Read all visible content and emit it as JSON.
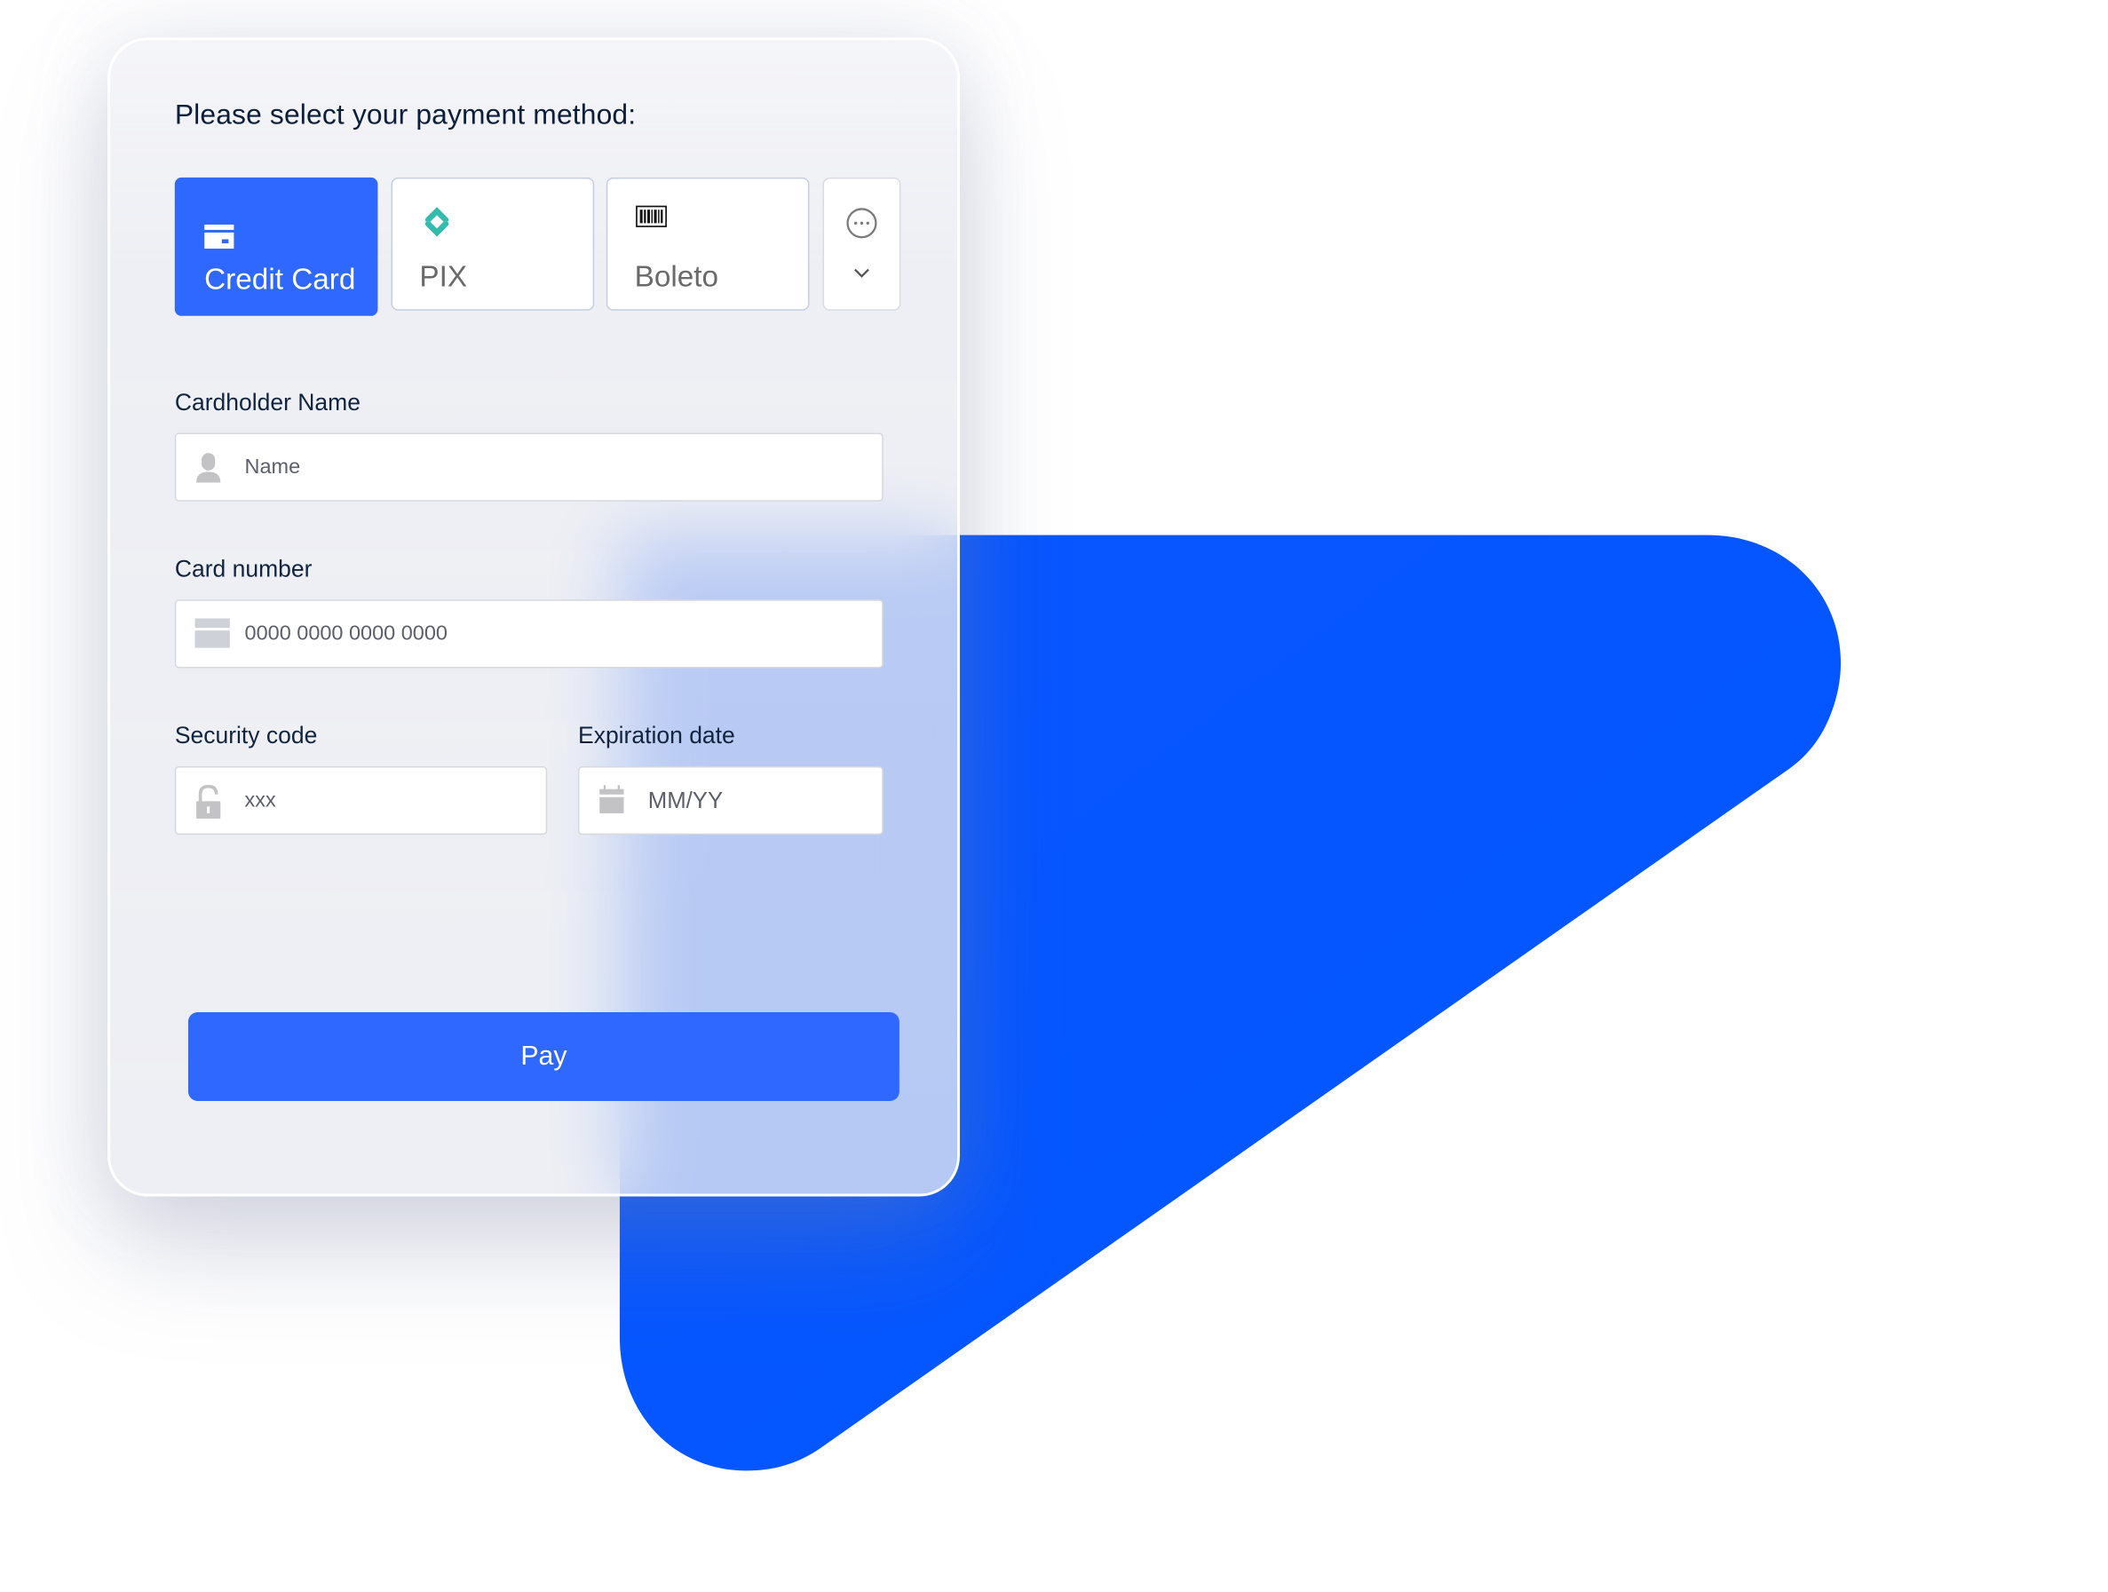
{
  "payment": {
    "title": "Please select your payment method:",
    "methods": [
      {
        "label": "Credit Card",
        "icon": "credit-card-icon",
        "selected": true
      },
      {
        "label": "PIX",
        "icon": "pix-icon",
        "selected": false
      },
      {
        "label": "Boleto",
        "icon": "barcode-icon",
        "selected": false
      }
    ],
    "more": {
      "icon": "more-options-icon",
      "chevron": "chevron-down-icon"
    }
  },
  "form": {
    "cardholder": {
      "label": "Cardholder Name",
      "placeholder": "Name",
      "icon": "user-icon"
    },
    "card_number": {
      "label": "Card number",
      "placeholder": "0000 0000 0000 0000",
      "icon": "card-icon"
    },
    "security_code": {
      "label": "Security code",
      "placeholder": "xxx",
      "icon": "lock-icon"
    },
    "expiration": {
      "label": "Expiration date",
      "placeholder": "MM/YY",
      "icon": "calendar-icon"
    },
    "pay_label": "Pay"
  },
  "colors": {
    "accent": "#2f68ff",
    "shape": "#0057ff",
    "pix": "#32bcad",
    "text_dark": "#0b1e3a"
  }
}
